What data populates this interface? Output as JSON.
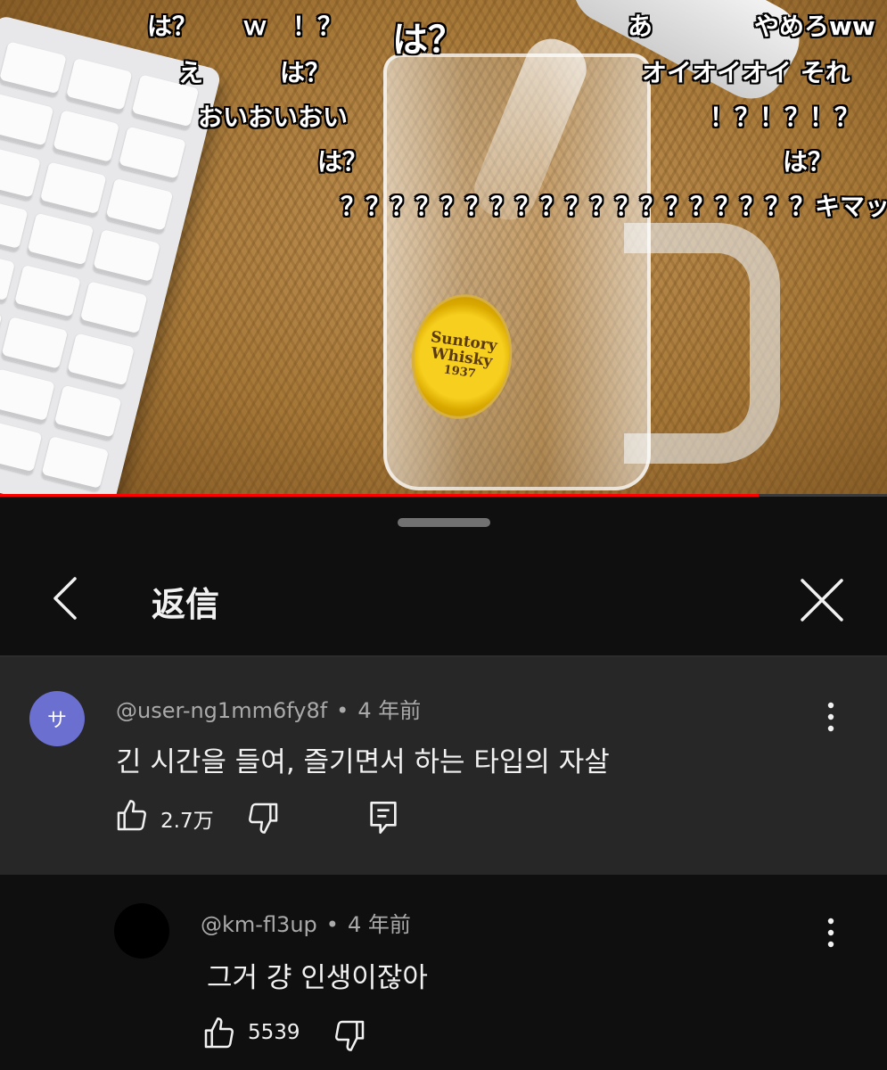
{
  "video": {
    "progress_fraction": 0.855,
    "mug_label": {
      "line1": "Suntory",
      "line2": "Whisky",
      "line3": "1937"
    },
    "danmaku": [
      {
        "text": "は？"
      },
      {
        "text": "ｗ"
      },
      {
        "text": "！？"
      },
      {
        "text": "は？"
      },
      {
        "text": "あ"
      },
      {
        "text": "やめろww"
      },
      {
        "text": "え"
      },
      {
        "text": "は？"
      },
      {
        "text": "オイオイオイ それ"
      },
      {
        "text": "おいおいおい"
      },
      {
        "text": "！？！？！？"
      },
      {
        "text": "は？"
      },
      {
        "text": "は？"
      },
      {
        "text": "？？？？？？？？？？？？？？？？？？？キマッ"
      }
    ]
  },
  "sheet": {
    "title": "返信",
    "back_icon": "chevron-left-icon",
    "close_icon": "close-icon"
  },
  "parent_comment": {
    "avatar_letter": "サ",
    "avatar_color": "#6b6fd0",
    "author": "@user-ng1mm6fy8f",
    "separator": "•",
    "time": "4 年前",
    "text": "긴 시간을 들여, 즐기면서 하는 타입의 자살",
    "likes": "2.7万",
    "background": "#272727"
  },
  "reply": {
    "avatar_color": "#000000",
    "author": "@km-fl3up",
    "separator": "•",
    "time": "4 年前",
    "text": "그거 걍 인생이잖아",
    "likes": "5539"
  }
}
